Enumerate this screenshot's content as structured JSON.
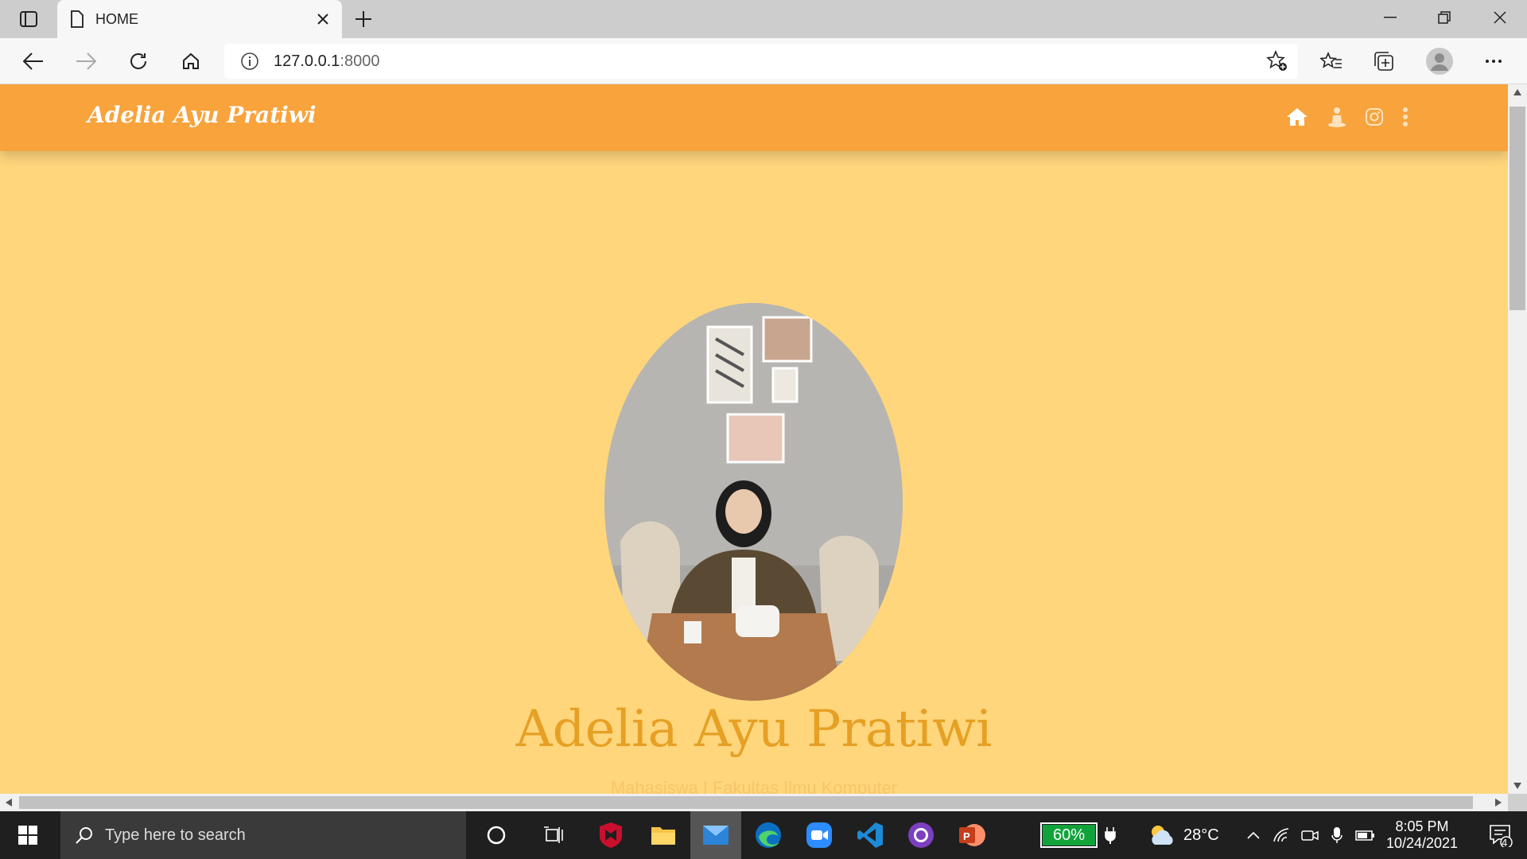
{
  "browser": {
    "tab_title": "HOME",
    "address_host": "127.0.0.1",
    "address_port": ":8000"
  },
  "site": {
    "brand": "Adelia Ayu Pratiwi",
    "hero_name": "Adelia Ayu Pratiwi",
    "hero_subtitle": "Mahasiswa | Fakultas Ilmu Komputer",
    "nav_icons": [
      "home-icon",
      "person-icon",
      "instagram-icon",
      "more-vertical-icon"
    ],
    "colors": {
      "navbar": "#f8a33c",
      "background": "#ffd67c",
      "accent": "#e6a024"
    }
  },
  "taskbar": {
    "search_placeholder": "Type here to search",
    "battery_percent": "60%",
    "temperature": "28°C",
    "time": "8:05 PM",
    "date": "10/24/2021",
    "notification_count": "4"
  }
}
